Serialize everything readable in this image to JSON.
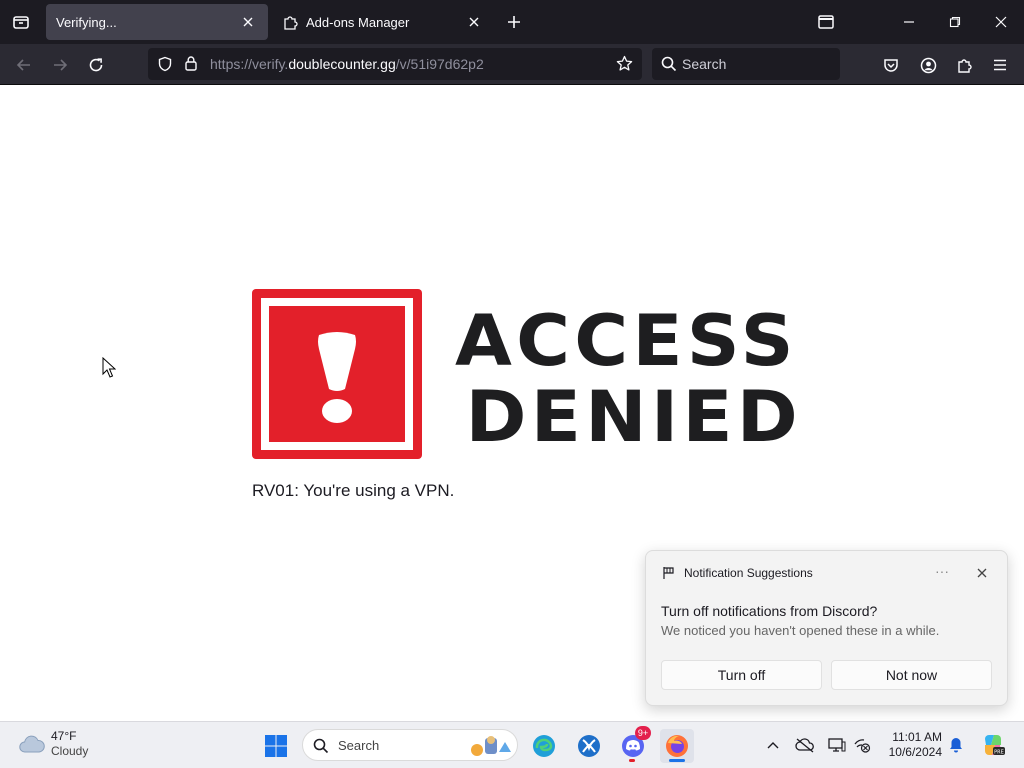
{
  "browser": {
    "tabs": [
      {
        "title": "Verifying...",
        "active": true
      },
      {
        "title": "Add-ons Manager",
        "active": false
      }
    ],
    "url": {
      "prefix": "https://verify.",
      "domain": "doublecounter.gg",
      "path": "/v/51i97d62p2"
    },
    "search_placeholder": "Search"
  },
  "page": {
    "heading_line1": "ACCESS",
    "heading_line2": "DENIED",
    "error_message": "RV01: You're using a VPN.",
    "accent_color": "#e3202a"
  },
  "notification": {
    "header": "Notification Suggestions",
    "more_label": "···",
    "title": "Turn off notifications from Discord?",
    "body": "We noticed you haven't opened these in a while.",
    "primary_button": "Turn off",
    "secondary_button": "Not now"
  },
  "taskbar": {
    "weather_temp": "47°F",
    "weather_condition": "Cloudy",
    "search_label": "Search",
    "discord_badge": "9+",
    "time": "11:01 AM",
    "date": "10/6/2024"
  }
}
